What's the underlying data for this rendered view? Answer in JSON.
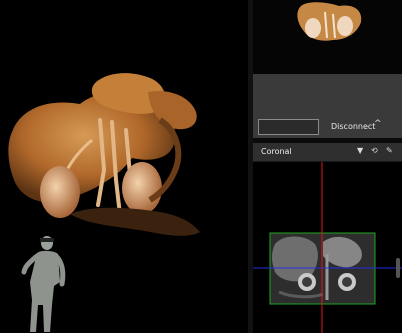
{
  "connect_panel": {
    "disconnect_label": "Disconnect",
    "caret": "^"
  },
  "coronal_panel": {
    "title": "Coronal"
  },
  "icons": {
    "dropdown": "chevron-down-icon",
    "sync": "sync-icon",
    "pin": "pin-icon"
  },
  "colors": {
    "accent_red": "#e01818",
    "accent_blue": "#2530e0",
    "roi_green": "#1fa31f",
    "organ_orange": "#b8702a"
  }
}
